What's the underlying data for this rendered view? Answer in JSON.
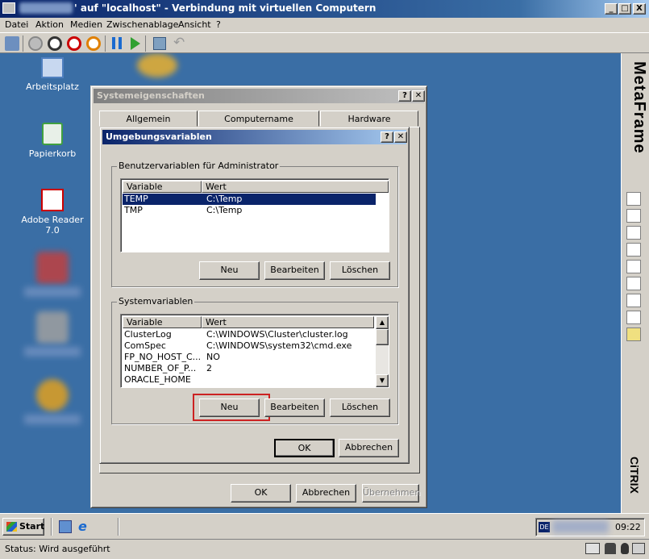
{
  "window": {
    "title": "' auf \"localhost\" - Verbindung mit virtuellen Computern",
    "controls": [
      "_",
      "□",
      "X"
    ]
  },
  "menu": [
    "Datei",
    "Aktion",
    "Medien",
    "Zwischenablage",
    "Ansicht",
    "?"
  ],
  "toolbar_icons": [
    "ctrl-alt-del-icon",
    "power-icon",
    "stop-icon",
    "shutdown-icon",
    "reset-icon",
    "pause-icon",
    "start-icon",
    "snapshot-icon",
    "undo-icon"
  ],
  "desktop": {
    "icons": [
      {
        "label": "Arbeitsplatz",
        "icon": "computer-icon"
      },
      {
        "label": "Papierkorb",
        "icon": "recycle-bin-icon"
      },
      {
        "label": "Adobe Reader 7.0",
        "icon": "adobe-reader-icon"
      }
    ]
  },
  "metaframe": {
    "brand": "MetaFrame",
    "vendor": "CiTRIX"
  },
  "sysprops": {
    "title": "Systemeigenschaften",
    "tabs": [
      "Allgemein",
      "Computername",
      "Hardware"
    ],
    "ok": "OK",
    "cancel": "Abbrechen",
    "apply": "Übernehmen"
  },
  "envvars": {
    "title": "Umgebungsvariablen",
    "user_group": "Benutzervariablen für Administrator",
    "columns": [
      "Variable",
      "Wert"
    ],
    "user_rows": [
      {
        "name": "TEMP",
        "value": "C:\\Temp",
        "selected": true
      },
      {
        "name": "TMP",
        "value": "C:\\Temp",
        "selected": false
      }
    ],
    "user_buttons": {
      "new": "Neu",
      "edit": "Bearbeiten",
      "delete": "Löschen"
    },
    "sys_group": "Systemvariablen",
    "sys_rows": [
      {
        "name": "ClusterLog",
        "value": "C:\\WINDOWS\\Cluster\\cluster.log"
      },
      {
        "name": "ComSpec",
        "value": "C:\\WINDOWS\\system32\\cmd.exe"
      },
      {
        "name": "FP_NO_HOST_C...",
        "value": "NO"
      },
      {
        "name": "NUMBER_OF_P...",
        "value": "2"
      },
      {
        "name": "ORACLE_HOME",
        "value": ""
      }
    ],
    "sys_buttons": {
      "new": "Neu",
      "edit": "Bearbeiten",
      "delete": "Löschen"
    },
    "ok": "OK",
    "cancel": "Abbrechen",
    "highlight_color": "#cc2222"
  },
  "taskbar": {
    "start": "Start",
    "lang": "DE",
    "time": "09:22"
  },
  "status": {
    "text": "Status: Wird ausgeführt"
  }
}
